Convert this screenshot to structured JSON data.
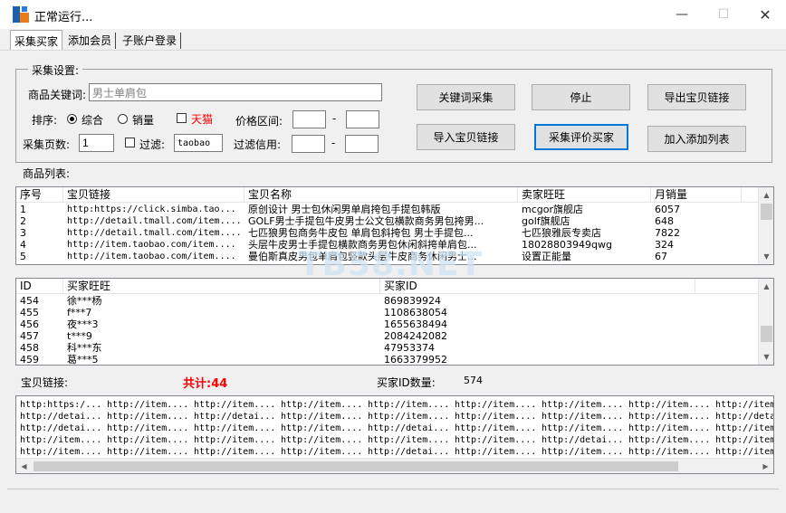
{
  "window": {
    "title": "正常运行..."
  },
  "tabs": [
    {
      "label": "采集买家"
    },
    {
      "label": "添加会员"
    },
    {
      "label": "子账户登录"
    }
  ],
  "settings": {
    "group_title": "采集设置:",
    "keyword_label": "商品关键词:",
    "keyword_value": "男士单肩包",
    "sort_label": "排序:",
    "sort_options": [
      "综合",
      "销量"
    ],
    "tmall_label": "天猫",
    "price_label": "价格区间:",
    "dash1": "-",
    "pages_label": "采集页数:",
    "pages_value": "1",
    "filter_label": "过滤:",
    "filter_value": "taobao",
    "credit_label": "过滤信用:",
    "dash2": "-"
  },
  "buttons": {
    "keyword_collect": "关键词采集",
    "stop": "停止",
    "export_links": "导出宝贝链接",
    "import_links": "导入宝贝链接",
    "collect_reviewers": "采集评价买家",
    "add_to_list": "加入添加列表"
  },
  "products": {
    "section_label": "商品列表:",
    "columns": [
      "序号",
      "宝贝链接",
      "宝贝名称",
      "卖家旺旺",
      "月销量"
    ],
    "rows": [
      [
        "1",
        "http:https://click.simba.tao...",
        "原创设计 男士包休闲男单肩挎包手提包韩版",
        "mcgor旗舰店",
        "6057"
      ],
      [
        "2",
        "http://detail.tmall.com/item....",
        "GOLF男士手提包牛皮男士公文包横款商务男包挎男...",
        "golf旗舰店",
        "648"
      ],
      [
        "3",
        "http://detail.tmall.com/item....",
        "七匹狼男包商务牛皮包 单肩包斜挎包 男士手提包...",
        "七匹狼雅辰专卖店",
        "7822"
      ],
      [
        "4",
        "http://item.taobao.com/item....",
        "头层牛皮男士手提包横款商务男包休闲斜挎单肩包...",
        "18028803949qwg",
        "324"
      ],
      [
        "5",
        "http://item.taobao.com/item....",
        "曼伯斯真皮男包单肩包竖款头层牛皮商务休闲男士...",
        "设置正能量",
        "67"
      ]
    ]
  },
  "buyers": {
    "columns": [
      "ID",
      "买家旺旺",
      "买家ID"
    ],
    "rows": [
      [
        "454",
        "徐***杨",
        "869839924"
      ],
      [
        "455",
        "f***7",
        "1108638054"
      ],
      [
        "456",
        "夜***3",
        "1655638494"
      ],
      [
        "457",
        "t***9",
        "2084242082"
      ],
      [
        "458",
        "科***东",
        "47953374"
      ],
      [
        "459",
        "葛***5",
        "1663379952"
      ]
    ]
  },
  "summary": {
    "links_label": "宝贝链接:",
    "total_label": "共计:44",
    "buyer_count_label": "买家ID数量:",
    "buyer_count_value": "574"
  },
  "links_grid": [
    [
      "http:https:/...",
      "http://item....",
      "http://item....",
      "http://item....",
      "http://item....",
      "http://item....",
      "http://item....",
      "http://item....",
      "http://item...."
    ],
    [
      "http://detai...",
      "http://item....",
      "http://detai...",
      "http://item....",
      "http://item....",
      "http://item....",
      "http://item....",
      "http://item....",
      "http://detai..."
    ],
    [
      "http://detai...",
      "http://item....",
      "http://item....",
      "http://item....",
      "http://detai...",
      "http://item....",
      "http://item....",
      "http://item....",
      "http://item...."
    ],
    [
      "http://item....",
      "http://item....",
      "http://item....",
      "http://item....",
      "http://item....",
      "http://item....",
      "http://detai...",
      "http://item....",
      "http://item...."
    ],
    [
      "http://item....",
      "http://item....",
      "http://item....",
      "http://item....",
      "http://detai...",
      "http://item....",
      "http://item....",
      "http://item....",
      "http://item...."
    ]
  ],
  "watermark": "TB58.NET",
  "colors": {
    "accent": "#0078d7",
    "total_red": "#ff0000",
    "tmall_red": "#ff0000"
  }
}
